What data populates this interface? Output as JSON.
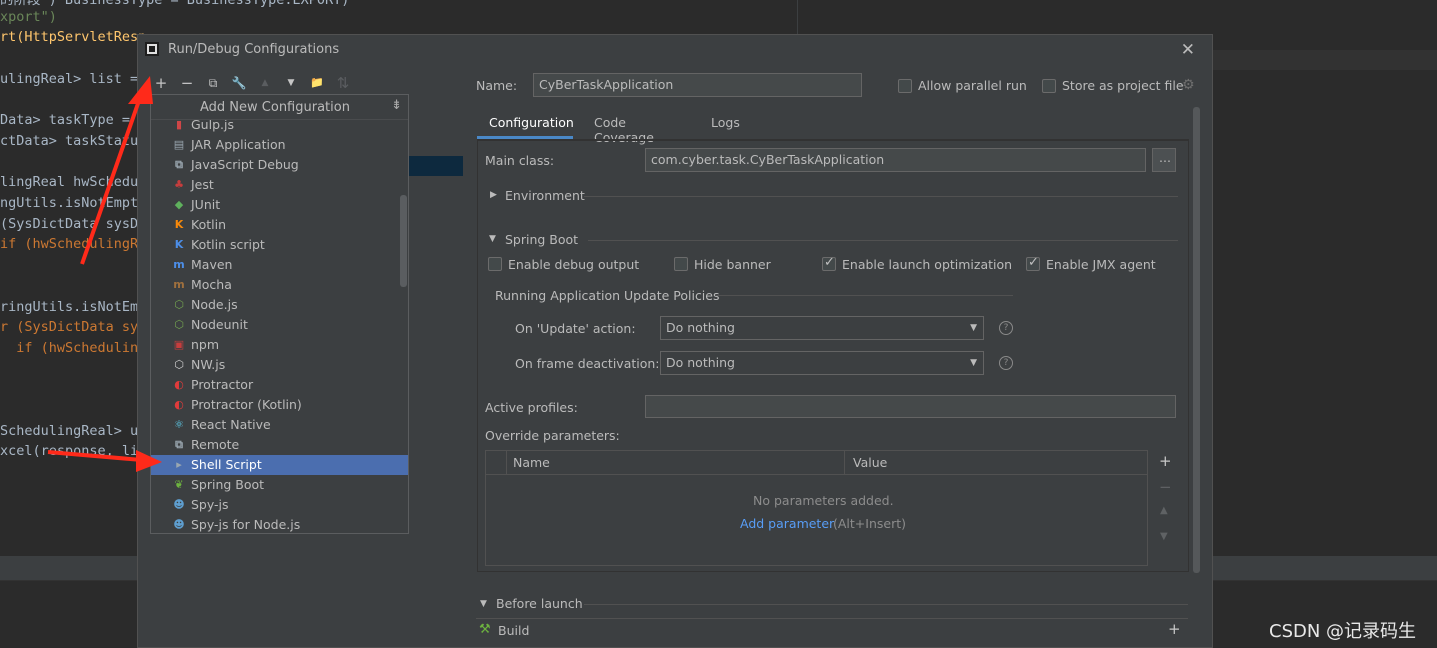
{
  "editor": {
    "lines": [
      {
        "text": "的阶段\") BusinessType = BusinessType.EXPORT)"
      },
      {
        "text": "xport\")"
      },
      {
        "text": "rt(HttpServletResp"
      },
      {
        "text": ""
      },
      {
        "text": "ulingReal> list = "
      },
      {
        "text": ""
      },
      {
        "text": "Data> taskType = "
      },
      {
        "text": "ctData> taskStatus"
      },
      {
        "text": ""
      },
      {
        "text": "lingReal hwSchedul"
      },
      {
        "text": "ngUtils.isNotEmpt"
      },
      {
        "text": "(SysDictData sysDi"
      },
      {
        "text": "if (hwSchedulingRe"
      },
      {
        "text": ""
      },
      {
        "text": ""
      },
      {
        "text": "ringUtils.isNotEmp"
      },
      {
        "text": "r (SysDictData sys"
      },
      {
        "text": "  if (hwScheduling"
      },
      {
        "text": ""
      },
      {
        "text": ""
      },
      {
        "text": ""
      },
      {
        "text": "SchedulingReal> ut"
      },
      {
        "text": "xcel(response, lis"
      }
    ],
    "watermark": "CSDN @记录码生"
  },
  "dialog": {
    "title": "Run/Debug Configurations",
    "close_label": "✕"
  },
  "toolbar": {
    "add": "+",
    "remove": "−",
    "copy": "⧉",
    "wrench": "🔧",
    "up": "▲",
    "down": "▼",
    "folder": "📁",
    "sort": "⇅"
  },
  "popup": {
    "title": "Add New Configuration",
    "sort_icon": "⇟",
    "items": [
      {
        "label": "Gulp.js",
        "icon": "gulp-icon",
        "glyph": "▮",
        "color": "#cf4647"
      },
      {
        "label": "JAR Application",
        "icon": "jar-icon",
        "glyph": "▤",
        "color": "#9aa7b0"
      },
      {
        "label": "JavaScript Debug",
        "icon": "js-debug-icon",
        "glyph": "⧉",
        "color": "#9aa7b0"
      },
      {
        "label": "Jest",
        "icon": "jest-icon",
        "glyph": "♣",
        "color": "#c63d3d"
      },
      {
        "label": "JUnit",
        "icon": "junit-icon",
        "glyph": "◆",
        "color": "#5fb15d"
      },
      {
        "label": "Kotlin",
        "icon": "kotlin-icon",
        "glyph": "K",
        "color": "#f88909"
      },
      {
        "label": "Kotlin script",
        "icon": "kotlin-script-icon",
        "glyph": "K",
        "color": "#4c8ee8"
      },
      {
        "label": "Maven",
        "icon": "maven-icon",
        "glyph": "m",
        "color": "#4c8ee8"
      },
      {
        "label": "Mocha",
        "icon": "mocha-icon",
        "glyph": "m",
        "color": "#a0703d"
      },
      {
        "label": "Node.js",
        "icon": "nodejs-icon",
        "glyph": "⬡",
        "color": "#73a350"
      },
      {
        "label": "Nodeunit",
        "icon": "nodeunit-icon",
        "glyph": "⬡",
        "color": "#73a350"
      },
      {
        "label": "npm",
        "icon": "npm-icon",
        "glyph": "▣",
        "color": "#c63d3d"
      },
      {
        "label": "NW.js",
        "icon": "nwjs-icon",
        "glyph": "⬡",
        "color": "#d0d0d0"
      },
      {
        "label": "Protractor",
        "icon": "protractor-icon",
        "glyph": "◐",
        "color": "#e03b3b"
      },
      {
        "label": "Protractor (Kotlin)",
        "icon": "protractor-kotlin-icon",
        "glyph": "◐",
        "color": "#e03b3b"
      },
      {
        "label": "React Native",
        "icon": "react-icon",
        "glyph": "⚛",
        "color": "#61dafb"
      },
      {
        "label": "Remote",
        "icon": "remote-icon",
        "glyph": "⧉",
        "color": "#9aa7b0"
      },
      {
        "label": "Shell Script",
        "icon": "shell-icon",
        "glyph": "▸",
        "color": "#9aa7b0"
      },
      {
        "label": "Spring Boot",
        "icon": "spring-boot-icon",
        "glyph": "❦",
        "color": "#6db33f"
      },
      {
        "label": "Spy-js",
        "icon": "spyjs-icon",
        "glyph": "☻",
        "color": "#5e9ecf"
      },
      {
        "label": "Spy-js for Node.js",
        "icon": "spyjs-node-icon",
        "glyph": "☻",
        "color": "#5e9ecf"
      }
    ],
    "selected_index": 17
  },
  "config": {
    "name_label": "Name:",
    "name_value": "CyBerTaskApplication",
    "allow_parallel": "Allow parallel run",
    "store_project": "Store as project file",
    "tabs": [
      "Configuration",
      "Code Coverage",
      "Logs"
    ],
    "main_class_label": "Main class:",
    "main_class_value": "com.cyber.task.CyBerTaskApplication",
    "browse": "...",
    "environment": "Environment",
    "spring_boot": "Spring Boot",
    "enable_debug": "Enable debug output",
    "hide_banner": "Hide banner",
    "enable_launch": "Enable launch optimization",
    "enable_jmx": "Enable JMX agent",
    "update_policies": "Running Application Update Policies",
    "on_update_label": "On 'Update' action:",
    "on_update_value": "Do nothing",
    "on_frame_label": "On frame deactivation:",
    "on_frame_value": "Do nothing",
    "active_profiles": "Active profiles:",
    "override_params": "Override parameters:",
    "col_name": "Name",
    "col_value": "Value",
    "no_params": "No parameters added.",
    "add_param": "Add parameter",
    "add_param_shortcut": "(Alt+Insert)",
    "before_launch": "Before launch",
    "build": "Build"
  },
  "colors": {
    "accent": "#4a88c7",
    "selection": "#4b6eaf",
    "link": "#589df6",
    "arrow": "#ff2a1a"
  }
}
